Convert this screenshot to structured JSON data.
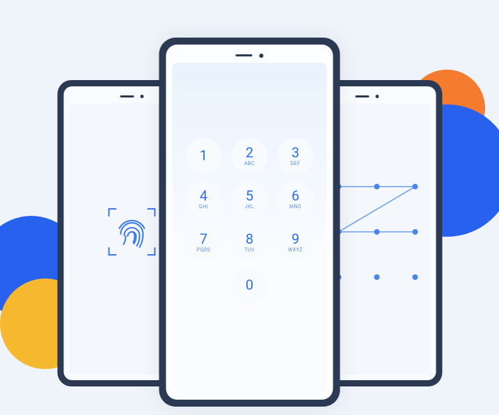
{
  "keypad": [
    {
      "num": "1",
      "sub": ""
    },
    {
      "num": "2",
      "sub": "ABC"
    },
    {
      "num": "3",
      "sub": "DEF"
    },
    {
      "num": "4",
      "sub": "GHI"
    },
    {
      "num": "5",
      "sub": "JKL"
    },
    {
      "num": "6",
      "sub": "MNO"
    },
    {
      "num": "7",
      "sub": "PQRS"
    },
    {
      "num": "8",
      "sub": "TUV"
    },
    {
      "num": "9",
      "sub": "WXYZ"
    },
    {
      "num": "0",
      "sub": ""
    }
  ]
}
